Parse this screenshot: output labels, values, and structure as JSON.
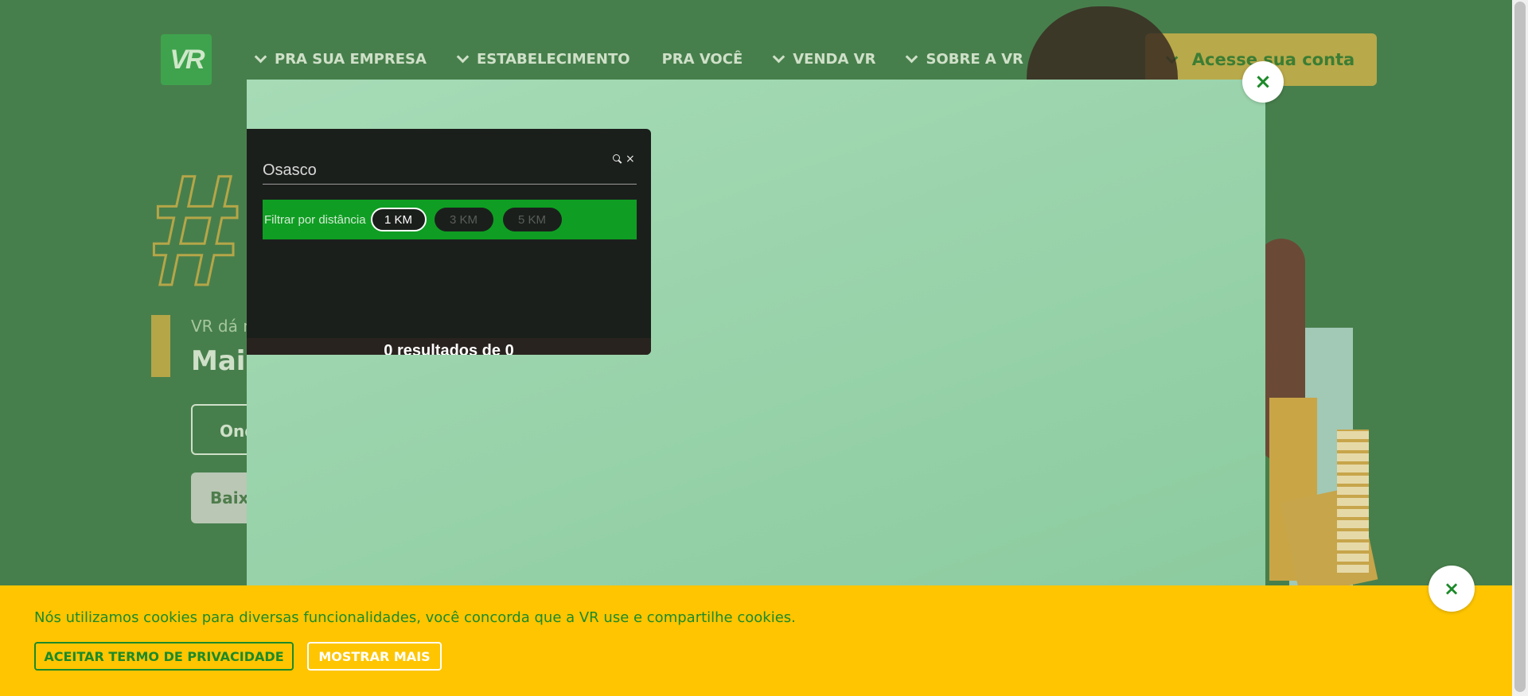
{
  "header": {
    "logo_text": "VR",
    "nav": [
      {
        "label": "PRA SUA EMPRESA",
        "chevron": true
      },
      {
        "label": "ESTABELECIMENTO",
        "chevron": true
      },
      {
        "label": "PRA VOCÊ",
        "chevron": false
      },
      {
        "label": "VENDA VR",
        "chevron": true
      },
      {
        "label": "SOBRE A VR",
        "chevron": true
      }
    ],
    "account_button": "Acesse sua conta"
  },
  "hero": {
    "hash": "#",
    "subtitle": "VR dá m",
    "title": "Mais",
    "button1": "Ond",
    "button2": "Baix"
  },
  "modal": {
    "close_icon": "×"
  },
  "search": {
    "value": "Osasco",
    "search_icon": "search-icon",
    "clear_icon": "×",
    "filter_label": "Filtrar por distância",
    "distances": [
      {
        "label": "1 KM",
        "active": true
      },
      {
        "label": "3 KM",
        "active": false
      },
      {
        "label": "5 KM",
        "active": false
      }
    ],
    "results_text": "0 resultados de 0"
  },
  "cookie": {
    "text": "Nós utilizamos cookies para diversas funcionalidades, você concorda que a VR use e compartilhe cookies.",
    "accept_button": "ACEITAR TERMO DE PRIVACIDADE",
    "more_button": "MOSTRAR MAIS",
    "close_icon": "×"
  },
  "colors": {
    "page_bg": "#477f4c",
    "accent_green": "#1c8a29",
    "filter_green": "#0f9e23",
    "cookie_yellow": "#fec500"
  }
}
